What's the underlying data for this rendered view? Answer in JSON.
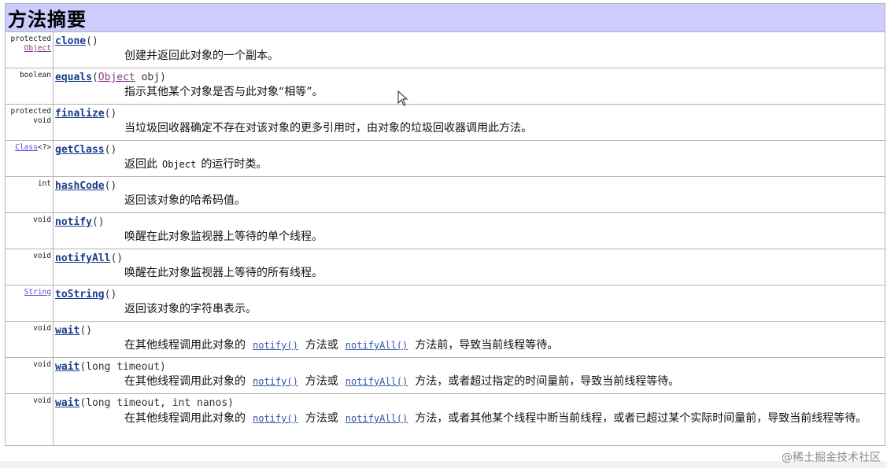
{
  "header": {
    "title": "方法摘要"
  },
  "methods": [
    {
      "modifier": "protected",
      "type_link": "Object",
      "name": "clone",
      "params": "()",
      "desc": "创建并返回此对象的一个副本。"
    },
    {
      "modifier": "boolean",
      "name": "equals",
      "params_open": "(",
      "param_type": "Object",
      "params_rest": " obj)",
      "desc": "指示其他某个对象是否与此对象“相等”。"
    },
    {
      "modifier": "protected",
      "modifier2": "void",
      "name": "finalize",
      "params": "()",
      "desc": "当垃圾回收器确定不存在对该对象的更多引用时，由对象的垃圾回收器调用此方法。"
    },
    {
      "type_link": "Class",
      "type_suffix": "<?>",
      "name": "getClass",
      "params": "()",
      "desc_a": "返回此",
      "desc_code": "Object",
      "desc_b": "的运行时类。"
    },
    {
      "modifier": "int",
      "name": "hashCode",
      "params": "()",
      "desc": "返回该对象的哈希码值。"
    },
    {
      "modifier": "void",
      "name": "notify",
      "params": "()",
      "desc": "唤醒在此对象监视器上等待的单个线程。"
    },
    {
      "modifier": "void",
      "name": "notifyAll",
      "params": "()",
      "desc": "唤醒在此对象监视器上等待的所有线程。"
    },
    {
      "type_link": "String",
      "name": "toString",
      "params": "()",
      "desc": "返回该对象的字符串表示。"
    },
    {
      "modifier": "void",
      "name": "wait",
      "params": "()",
      "desc_a": "在其他线程调用此对象的",
      "link1": "notify()",
      "desc_b": "方法或",
      "link2": "notifyAll()",
      "desc_c": "方法前，导致当前线程等待。"
    },
    {
      "modifier": "void",
      "name": "wait",
      "params": "(long timeout)",
      "desc_a": "在其他线程调用此对象的",
      "link1": "notify()",
      "desc_b": "方法或",
      "link2": "notifyAll()",
      "desc_c": "方法，或者超过指定的时间量前，导致当前线程等待。"
    },
    {
      "modifier": "void",
      "name": "wait",
      "params": "(long timeout, int nanos)",
      "desc_a": "在其他线程调用此对象的",
      "link1": "notify()",
      "desc_b": "方法或",
      "link2": "notifyAll()",
      "desc_c": "方法，或者其他某个线程中断当前线程，或者已超过某个实际时间量前，导致当前线程等待。"
    }
  ],
  "watermark": "@稀土掘金技术社区"
}
